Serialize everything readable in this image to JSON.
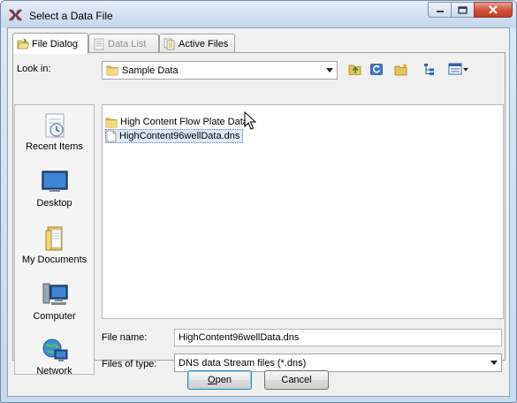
{
  "window": {
    "title": "Select a Data File"
  },
  "tabs": [
    {
      "label": "File Dialog",
      "state": "active"
    },
    {
      "label": "Data List",
      "state": "disabled"
    },
    {
      "label": "Active Files",
      "state": "normal"
    }
  ],
  "look_in": {
    "label": "Look in:",
    "value": "Sample Data"
  },
  "places": [
    {
      "label": "Recent Items",
      "icon": "recent-items-icon"
    },
    {
      "label": "Desktop",
      "icon": "desktop-icon"
    },
    {
      "label": "My Documents",
      "icon": "my-documents-icon"
    },
    {
      "label": "Computer",
      "icon": "computer-icon"
    },
    {
      "label": "Network",
      "icon": "network-icon"
    }
  ],
  "files": [
    {
      "name": "High Content Flow Plate Data",
      "type": "folder",
      "selected": false
    },
    {
      "name": "HighContent96wellData.dns",
      "type": "file",
      "selected": true
    }
  ],
  "file_name": {
    "label": "File name:",
    "value": "HighContent96wellData.dns"
  },
  "file_type": {
    "label": "Files of type:",
    "value": "DNS data Stream files (*.dns)"
  },
  "buttons": {
    "open_first": "O",
    "open_rest": "pen",
    "cancel": "Cancel"
  },
  "colors": {
    "folder": "#e8c25a",
    "selection": "#dfeaf8",
    "close_button": "#c8452c"
  }
}
